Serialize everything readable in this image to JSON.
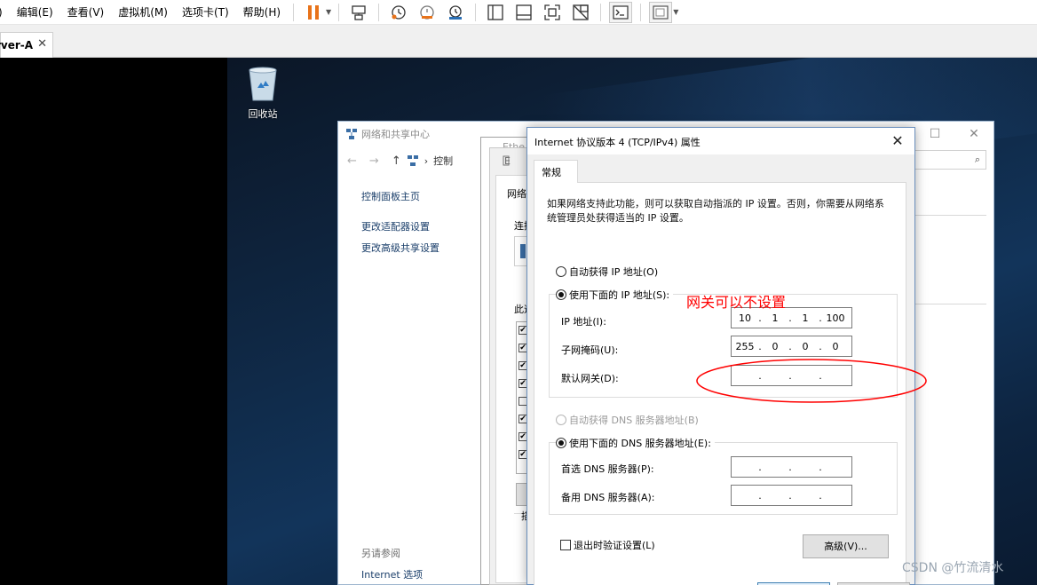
{
  "menubar": {
    "items": [
      "编辑(E)",
      "查看(V)",
      "虚拟机(M)",
      "选项卡(T)",
      "帮助(H)"
    ],
    "first_fragment": ")"
  },
  "tab": {
    "label": "rver-A",
    "close": "✕"
  },
  "desktop": {
    "recycle_bin_label": "回收站"
  },
  "network_window": {
    "title": "网络和共享中心",
    "breadcrumb": "控制",
    "side_links": [
      "控制面板主页",
      "更改适配器设置",
      "更改高级共享设置"
    ],
    "see_also": "另请参阅",
    "internet_options": "Internet 选项"
  },
  "ethernet_window": {
    "title_fragment": "Ethe",
    "inner_title_fragment": "E",
    "tab_fragment": "网络",
    "connect_fragment": "连接",
    "this_fragment": "此道",
    "desc_fragment": "描"
  },
  "ipv4_dialog": {
    "title": "Internet 协议版本 4 (TCP/IPv4) 属性",
    "tab": "常规",
    "intro": "如果网络支持此功能，则可以获取自动指派的 IP 设置。否则，你需要从网络系统管理员处获得适当的 IP 设置。",
    "auto_ip": "自动获得 IP 地址(O)",
    "manual_ip": "使用下面的 IP 地址(S):",
    "ip_label": "IP 地址(I):",
    "ip_value": [
      "10",
      "1",
      "1",
      "100"
    ],
    "mask_label": "子网掩码(U):",
    "mask_value": [
      "255",
      "0",
      "0",
      "0"
    ],
    "gateway_label": "默认网关(D):",
    "gateway_value": [
      "",
      "",
      "",
      ""
    ],
    "auto_dns": "自动获得 DNS 服务器地址(B)",
    "manual_dns": "使用下面的 DNS 服务器地址(E):",
    "preferred_dns_label": "首选 DNS 服务器(P):",
    "alternate_dns_label": "备用 DNS 服务器(A):",
    "validate_on_exit": "退出时验证设置(L)",
    "advanced_button": "高级(V)...",
    "selected_ip_mode": "manual",
    "selected_dns_mode": "manual"
  },
  "annotation": {
    "text": "网关可以不设置",
    "color": "#ff0000"
  },
  "watermark": "CSDN @竹流清水"
}
